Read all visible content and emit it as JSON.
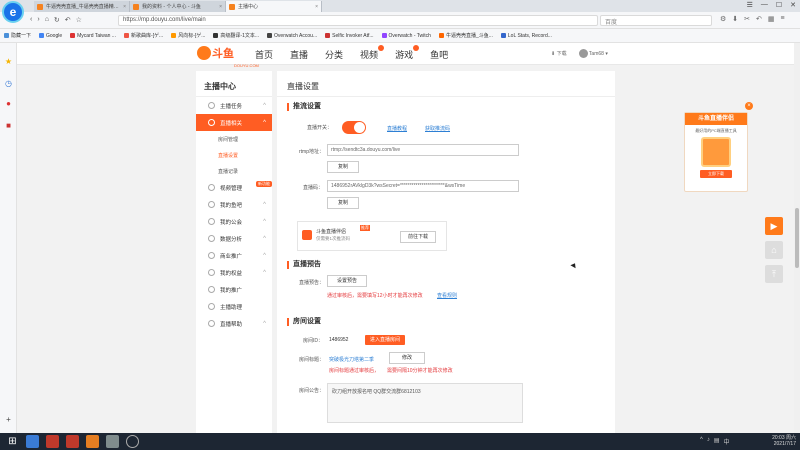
{
  "browser": {
    "logo_glyph": "e",
    "tabs": [
      {
        "label": "牛逼壳壳直播_牛逼壳壳直播精彩视频_..."
      },
      {
        "label": "我的资料 - 个人中心 - 斗鱼"
      },
      {
        "label": "主播中心",
        "active": true
      }
    ],
    "url": "https://mp.douyu.com/live/main",
    "search_placeholder": "百度",
    "window_controls": [
      "☰",
      "—",
      "☐",
      "✕"
    ],
    "bookmarks": [
      {
        "label": "隐藏一下",
        "color": "#4a90d9"
      },
      {
        "label": "Google",
        "color": "#4285f4"
      },
      {
        "label": "Mycard Taiwan ...",
        "color": "#d33"
      },
      {
        "label": "新歌曲库-[ゲ...",
        "color": "#e54"
      },
      {
        "label": "风向标-[ゲ...",
        "color": "#f90"
      },
      {
        "label": "高级翻译-1文本...",
        "color": "#333"
      },
      {
        "label": "Overwatch Accou...",
        "color": "#444"
      },
      {
        "label": "Selfic Invoker Atf...",
        "color": "#c33"
      },
      {
        "label": "Overwatch - Twitch",
        "color": "#9146ff"
      },
      {
        "label": "牛逼壳壳直播_斗鱼...",
        "color": "#f60"
      },
      {
        "label": "LoL Stats, Record...",
        "color": "#36c"
      }
    ]
  },
  "site": {
    "logo_text": "斗鱼",
    "logo_sub": "DOUYU.COM",
    "nav": [
      "首页",
      "直播",
      "分类",
      "视频",
      "游戏",
      "鱼吧"
    ],
    "header_right": {
      "download": "下载",
      "user": "Tam68"
    }
  },
  "leftmenu": {
    "title": "主播中心",
    "items": [
      {
        "label": "主播任务",
        "active": false
      },
      {
        "label": "直播相关",
        "active": true
      },
      {
        "label": "房间管理",
        "sub": true
      },
      {
        "label": "直播设置",
        "sub": true,
        "active": true
      },
      {
        "label": "直播记录",
        "sub": true
      },
      {
        "label": "视频管理",
        "active": false,
        "badge": "新功能"
      },
      {
        "label": "我的鱼吧",
        "active": false
      },
      {
        "label": "我的公会",
        "active": false
      },
      {
        "label": "数据分析",
        "active": false
      },
      {
        "label": "商业推广",
        "active": false
      },
      {
        "label": "我的权益",
        "active": false
      },
      {
        "label": "我的推广",
        "active": false
      },
      {
        "label": "主播助理",
        "active": false
      },
      {
        "label": "直播帮助",
        "active": false
      }
    ]
  },
  "main": {
    "title": "直播设置",
    "push": {
      "section": "推流设置",
      "toggle_label": "直播开关：",
      "link1": "直播教程",
      "link2": "获取推流码",
      "rtmp_label": "rtmp地址：",
      "rtmp_value": "rtmp://sendtc3a.douyu.com/live",
      "copy1": "复制",
      "code_label": "直播码：",
      "code_value": "1486952rAVklgD3k?wsSecret=***********************&wsTime",
      "copy2": "复制",
      "promo_title": "斗鱼直播伴侣",
      "promo_sub": "仅需要1次推流码",
      "promo_hot": "推荐",
      "promo_btn": "前往下载"
    },
    "preview": {
      "section": "直播预告",
      "label": "直播预告：",
      "btn": "设置预告",
      "warn": "通过审核后，需要填写12小时才能再次修改",
      "link": "查看规则"
    },
    "room": {
      "section": "房间设置",
      "id_label": "房间ID：",
      "id_value": "1486952",
      "id_btn": "进入直播房间",
      "title_label": "房间标题：",
      "title_value": "突破极光刀塔第二季",
      "title_btn": "修改",
      "title_warn1": "房间标题通过审核后，",
      "title_warn2": "需要间隔10分钟才能再次修改",
      "notice_label": "房间公告：",
      "notice_value": "砍刀组开放报名吧 QQ群交流群6812103"
    }
  },
  "ad": {
    "title": "斗鱼直播伴侣",
    "sub": "最好用的PC端直播工具",
    "download": "立即下载",
    "close": "×",
    "float_buttons": [
      "▶",
      "⌂",
      "⤒"
    ]
  },
  "taskbar": {
    "time": "20:03 周六",
    "date": "2021/7/17",
    "app_colors": [
      "#3a7bd5",
      "#c0392b",
      "#c0392b",
      "#e67e22",
      "#7f8c8d"
    ]
  }
}
